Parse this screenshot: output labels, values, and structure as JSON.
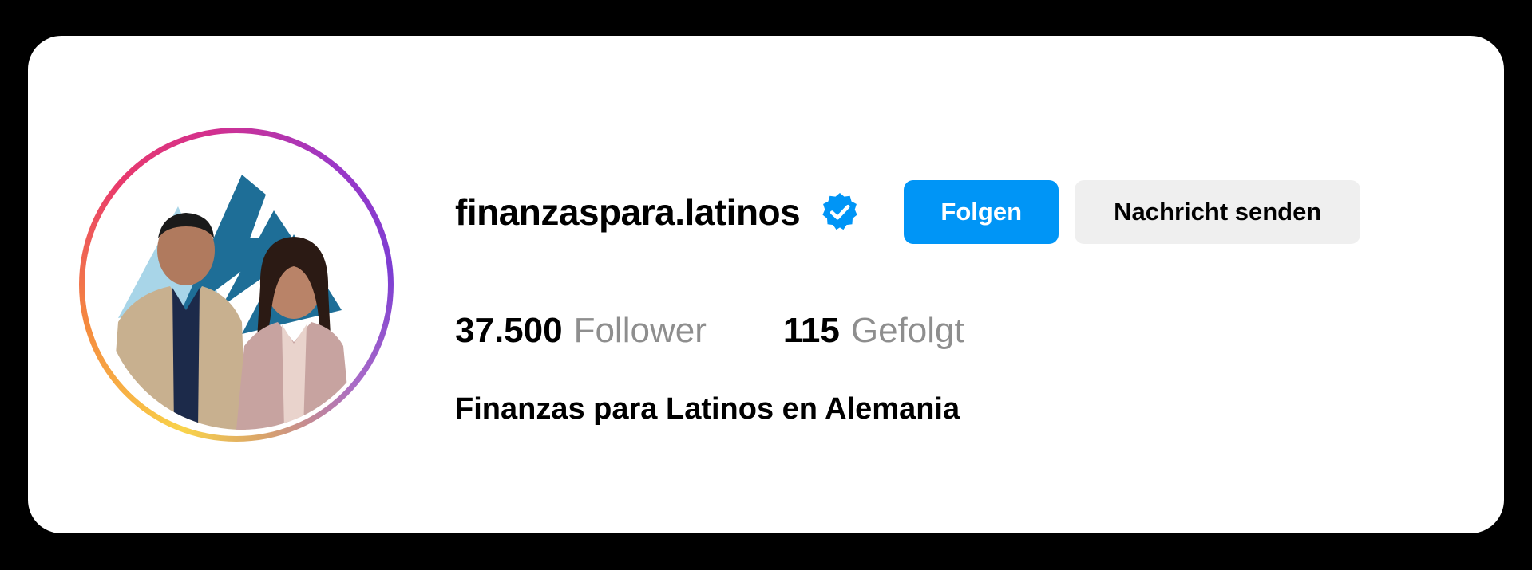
{
  "profile": {
    "username": "finanzaspara.latinos",
    "verified_icon": "verified-badge-icon",
    "follow_label": "Folgen",
    "message_label": "Nachricht senden",
    "bio": "Finanzas para Latinos en Alemania"
  },
  "stats": {
    "followers": {
      "count": "37.500",
      "label": "Follower"
    },
    "following": {
      "count": "115",
      "label": "Gefolgt"
    }
  },
  "colors": {
    "accent": "#0095f6",
    "secondary_button": "#efefef",
    "muted_text": "#8e8e8e",
    "background": "#000000",
    "card": "#ffffff"
  }
}
